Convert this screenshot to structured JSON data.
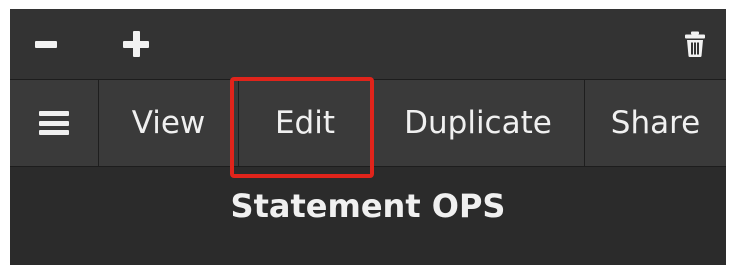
{
  "toolbar": {
    "zoom_out_icon": "minus-icon",
    "zoom_in_icon": "plus-icon",
    "delete_icon": "trash-icon"
  },
  "actions": {
    "menu_icon": "hamburger-icon",
    "view_label": "View",
    "edit_label": "Edit",
    "duplicate_label": "Duplicate",
    "share_label": "Share"
  },
  "panel": {
    "title": "Statement OPS"
  },
  "colors": {
    "background": "#2b2b2b",
    "toolbar": "#333333",
    "actionbar": "#3a3a3a",
    "text": "#f0f0f0",
    "highlight": "#e0241b"
  }
}
